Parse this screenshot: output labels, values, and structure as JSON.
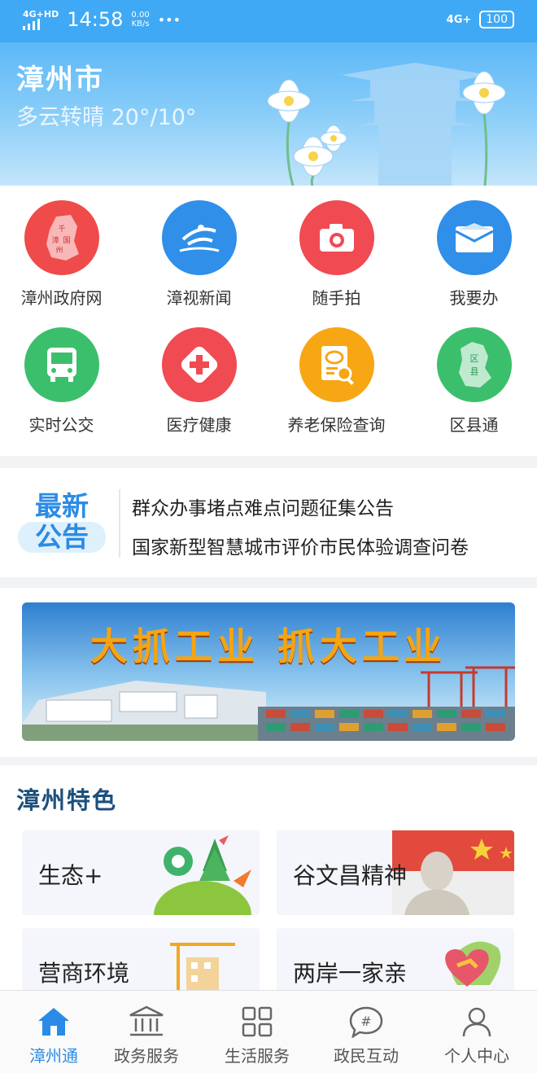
{
  "status_bar": {
    "network": "4G+HD",
    "time": "14:58",
    "speed_value": "0.00",
    "speed_unit": "KB/s",
    "dots": "•••",
    "network_right": "4G+",
    "battery": "100"
  },
  "hero": {
    "city": "漳州市",
    "weather": "多云转晴 20°/10°"
  },
  "services": [
    {
      "label": "漳州政府网",
      "icon": "zhangzhou-map-seal-icon",
      "color": "#ef4b4b"
    },
    {
      "label": "漳视新闻",
      "icon": "news-logo-icon",
      "color": "#2f8fe9"
    },
    {
      "label": "随手拍",
      "icon": "camera-icon",
      "color": "#f04a52"
    },
    {
      "label": "我要办",
      "icon": "envelope-icon",
      "color": "#2f8fe9"
    },
    {
      "label": "实时公交",
      "icon": "bus-icon",
      "color": "#3cbf6c"
    },
    {
      "label": "医疗健康",
      "icon": "medical-cross-icon",
      "color": "#f04a52"
    },
    {
      "label": "养老保险查询",
      "icon": "insurance-search-icon",
      "color": "#f7a614"
    },
    {
      "label": "区县通",
      "icon": "district-map-icon",
      "color": "#3cbf6c"
    }
  ],
  "notice": {
    "badge_line1": "最新",
    "badge_line2": "公告",
    "items": [
      "群众办事堵点难点问题征集公告",
      "国家新型智慧城市评价市民体验调查问卷"
    ]
  },
  "banner": {
    "slogan": "大抓工业  抓大工业"
  },
  "features": {
    "title": "漳州特色",
    "cards": [
      "生态+",
      "谷文昌精神",
      "营商环境",
      "两岸一家亲"
    ]
  },
  "tabbar": {
    "tabs": [
      {
        "label": "漳州通",
        "icon": "home-icon"
      },
      {
        "label": "政务服务",
        "icon": "government-building-icon"
      },
      {
        "label": "生活服务",
        "icon": "grid-apps-icon"
      },
      {
        "label": "政民互动",
        "icon": "chat-hashtag-icon"
      },
      {
        "label": "个人中心",
        "icon": "user-icon"
      }
    ],
    "active_color": "#2a8be6"
  }
}
